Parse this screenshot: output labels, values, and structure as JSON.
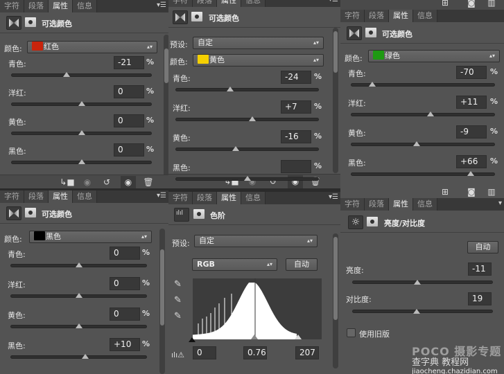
{
  "tabs": [
    "字符",
    "段落",
    "属性",
    "信息"
  ],
  "active_tab": "属性",
  "panels": {
    "red": {
      "title": "可选颜色",
      "color_label": "颜色:",
      "color_value": "红色",
      "swatch": "#c8240c",
      "sliders": [
        {
          "label": "青色:",
          "value": "-21",
          "level": -21
        },
        {
          "label": "洋红:",
          "value": "0",
          "level": 0
        },
        {
          "label": "黄色:",
          "value": "0",
          "level": 0
        },
        {
          "label": "黑色:",
          "value": "0",
          "level": 0
        }
      ],
      "unit": "%"
    },
    "yellow": {
      "title": "可选颜色",
      "preset_label": "预设:",
      "preset_value": "自定",
      "color_label": "颜色:",
      "color_value": "黄色",
      "swatch": "#f5d000",
      "sliders": [
        {
          "label": "青色:",
          "value": "-24",
          "level": -24
        },
        {
          "label": "洋红:",
          "value": "+7",
          "level": 7
        },
        {
          "label": "黄色:",
          "value": "-16",
          "level": -16
        },
        {
          "label": "黑色:",
          "value": "",
          "level": 0
        }
      ],
      "unit": "%"
    },
    "green": {
      "title": "可选颜色",
      "color_label": "颜色:",
      "color_value": "绿色",
      "swatch": "#1e9a12",
      "sliders": [
        {
          "label": "青色:",
          "value": "-70",
          "level": -70
        },
        {
          "label": "洋红:",
          "value": "+11",
          "level": 11
        },
        {
          "label": "黄色:",
          "value": "-9",
          "level": -9
        },
        {
          "label": "黑色:",
          "value": "+66",
          "level": 66
        }
      ],
      "unit": "%"
    },
    "black": {
      "title": "可选颜色",
      "color_label": "颜色:",
      "color_value": "黑色",
      "swatch": "#000000",
      "sliders": [
        {
          "label": "青色:",
          "value": "0",
          "level": 0
        },
        {
          "label": "洋红:",
          "value": "0",
          "level": 0
        },
        {
          "label": "黄色:",
          "value": "0",
          "level": 0
        },
        {
          "label": "黑色:",
          "value": "+10",
          "level": 10
        }
      ],
      "unit": "%"
    },
    "levels": {
      "title": "色阶",
      "preset_label": "预设:",
      "preset_value": "自定",
      "channel": "RGB",
      "auto_label": "自动",
      "input_black": "0",
      "input_gamma": "0.76",
      "input_white": "207"
    },
    "brightness": {
      "title": "亮度/对比度",
      "auto_label": "自动",
      "brightness_label": "亮度:",
      "brightness_value": "-11",
      "brightness_level": -11,
      "contrast_label": "对比度:",
      "contrast_value": "19",
      "contrast_level": 19,
      "legacy_label": "使用旧版"
    }
  },
  "footer_icons": [
    "clip-to-layer-icon",
    "view-previous-icon",
    "reset-icon",
    "visibility-eye-icon",
    "trash-icon"
  ],
  "watermark": {
    "line1": "POCO 摄影专题",
    "line2": "查字典 教程网",
    "line3": "jiaocheng.chazidian.com"
  }
}
